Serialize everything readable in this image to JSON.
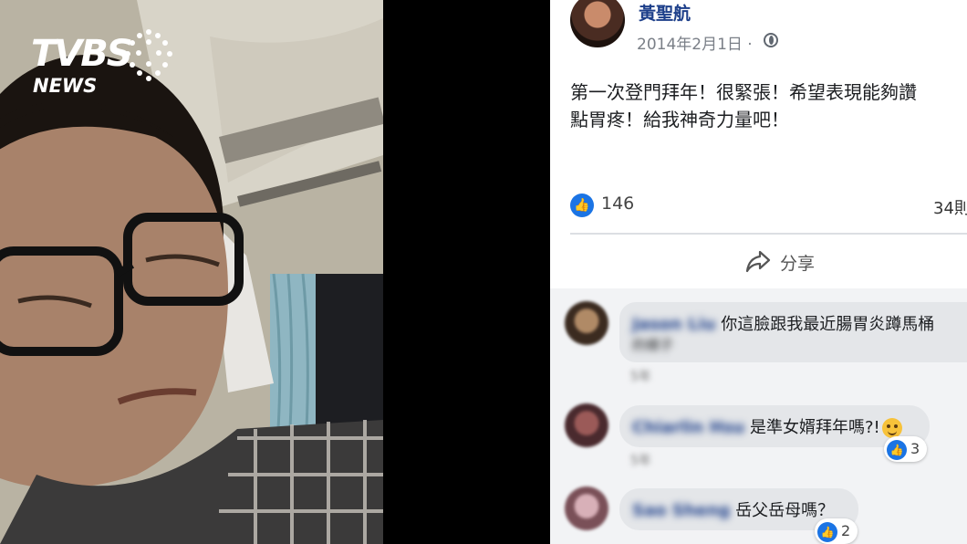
{
  "logo": {
    "main": "TVBS",
    "sub": "NEWS"
  },
  "post": {
    "author": "黃聖航",
    "date": "2014年2月1日 ·",
    "content": "第一次登門拜年！很緊張！希望表現能夠讚\n點胃疼！給我神奇力量吧！",
    "likes": "146",
    "comments_count": "34則",
    "share_label": "分享"
  },
  "comments": [
    {
      "name": "Jason Liu",
      "text": "你這臉跟我最近腸胃炎蹲馬桶",
      "text2": "的樣子",
      "time": "5年"
    },
    {
      "name": "Chiarlin Hsu",
      "text": "是準女婿拜年嗎?!",
      "time": "5年",
      "reactions": "3"
    },
    {
      "name": "Sao Sheng",
      "text": "岳父岳母嗎？",
      "time": "5年",
      "reactions": "2"
    }
  ],
  "icons": [
    "globe-icon",
    "like-icon",
    "share-icon",
    "thumbs-up-icon",
    "emoji-icon"
  ],
  "colors": {
    "facebook_blue": "#1b74e4",
    "name_blue": "#1d3f8a"
  }
}
